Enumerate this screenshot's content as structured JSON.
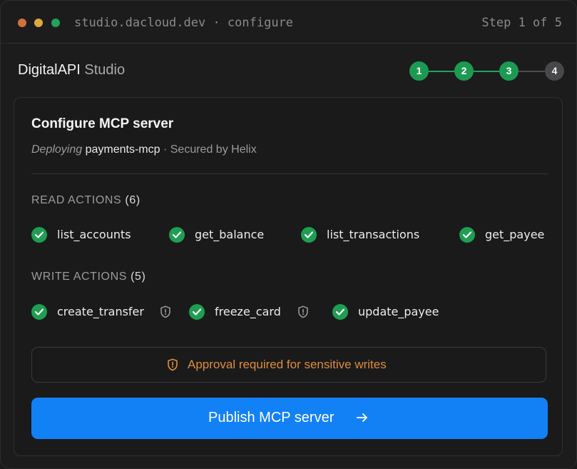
{
  "window": {
    "url": "studio.dacloud.dev · configure",
    "step_indicator": "Step 1 of 5"
  },
  "brand": {
    "name_primary": "DigitalAPI",
    "name_secondary": "Studio"
  },
  "stepper": {
    "steps": [
      {
        "label": "1",
        "state": "complete"
      },
      {
        "label": "2",
        "state": "complete"
      },
      {
        "label": "3",
        "state": "complete"
      },
      {
        "label": "4",
        "state": "pending"
      }
    ]
  },
  "card": {
    "title": "Configure MCP server",
    "subtitle": {
      "deploying": "Deploying",
      "server_name": "payments-mcp",
      "secured": " · Secured by Helix"
    }
  },
  "read_actions": {
    "label": "READ ACTIONS",
    "count": "(6)",
    "items": [
      {
        "name": "list_accounts",
        "enabled": true,
        "approval": false
      },
      {
        "name": "get_balance",
        "enabled": true,
        "approval": false
      },
      {
        "name": "list_transactions",
        "enabled": true,
        "approval": false
      },
      {
        "name": "get_payee",
        "enabled": true,
        "approval": false
      }
    ]
  },
  "write_actions": {
    "label": "WRITE ACTIONS",
    "count": "(5)",
    "items": [
      {
        "name": "create_transfer",
        "enabled": true,
        "approval": true
      },
      {
        "name": "freeze_card",
        "enabled": true,
        "approval": true
      },
      {
        "name": "update_payee",
        "enabled": true,
        "approval": false
      }
    ]
  },
  "approval_notice": {
    "text": "Approval required for sensitive writes",
    "icon": "shield-alert-icon"
  },
  "publish_button": {
    "label": "Publish MCP server",
    "icon": "arrow-right-icon"
  },
  "colors": {
    "success": "#1f9e52",
    "primary": "#1281f5",
    "warning": "#de8d3a",
    "pending": "#48484b"
  }
}
